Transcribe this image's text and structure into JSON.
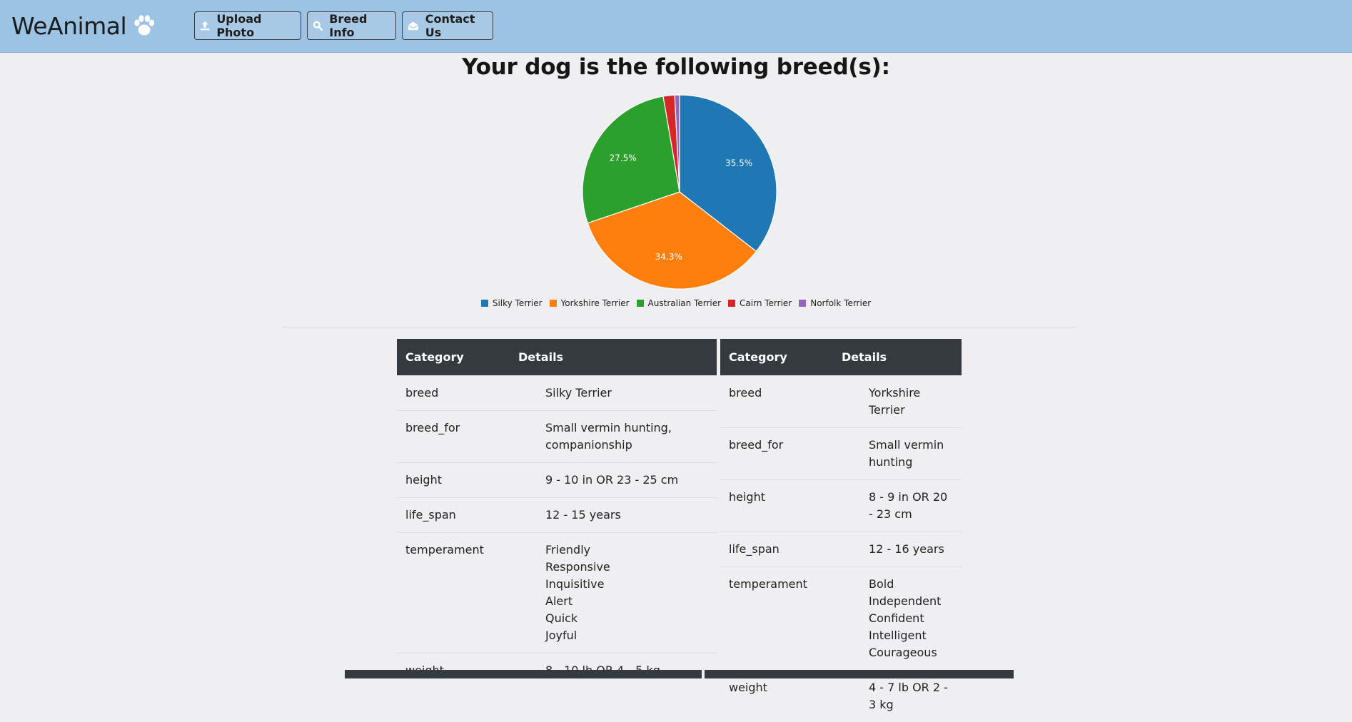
{
  "header": {
    "brand": "WeAnimal",
    "buttons": [
      {
        "label": "Upload Photo",
        "icon": "upload-icon"
      },
      {
        "label": "Breed Info",
        "icon": "search-icon"
      },
      {
        "label": "Contact Us",
        "icon": "envelope-icon"
      }
    ]
  },
  "main": {
    "title": "Your dog is the following breed(s):"
  },
  "chart_data": {
    "type": "pie",
    "title": "",
    "categories": [
      "Silky Terrier",
      "Yorkshire Terrier",
      "Australian Terrier",
      "Cairn Terrier",
      "Norfolk Terrier"
    ],
    "values": [
      35.5,
      34.3,
      27.5,
      1.9,
      0.8
    ],
    "data_labels": [
      "35.5%",
      "34.3%",
      "27.5%",
      "",
      ""
    ],
    "colors": [
      "#1f77b4",
      "#ff7f0e",
      "#2ca02c",
      "#d62728",
      "#9467bd"
    ],
    "legend": "bottom"
  },
  "tables": [
    {
      "headers": [
        "Category",
        "Details"
      ],
      "rows": [
        {
          "category": "breed",
          "details": [
            "Silky Terrier"
          ]
        },
        {
          "category": "breed_for",
          "details": [
            "Small vermin hunting, companionship"
          ]
        },
        {
          "category": "height",
          "details": [
            "9 - 10 in OR 23 - 25 cm"
          ]
        },
        {
          "category": "life_span",
          "details": [
            "12 - 15 years"
          ]
        },
        {
          "category": "temperament",
          "details": [
            "Friendly",
            "Responsive",
            "Inquisitive",
            "Alert",
            "Quick",
            "Joyful"
          ]
        },
        {
          "category": "weight",
          "details": [
            "8 - 10 lb OR 4 - 5 kg"
          ]
        }
      ]
    },
    {
      "headers": [
        "Category",
        "Details"
      ],
      "rows": [
        {
          "category": "breed",
          "details": [
            "Yorkshire Terrier"
          ]
        },
        {
          "category": "breed_for",
          "details": [
            "Small vermin hunting"
          ]
        },
        {
          "category": "height",
          "details": [
            "8 - 9 in OR 20 - 23 cm"
          ]
        },
        {
          "category": "life_span",
          "details": [
            "12 - 16 years"
          ]
        },
        {
          "category": "temperament",
          "details": [
            "Bold",
            "Independent",
            "Confident",
            "Intelligent",
            "Courageous"
          ]
        },
        {
          "category": "weight",
          "details": [
            "4 - 7 lb OR 2 - 3 kg"
          ]
        }
      ]
    }
  ]
}
